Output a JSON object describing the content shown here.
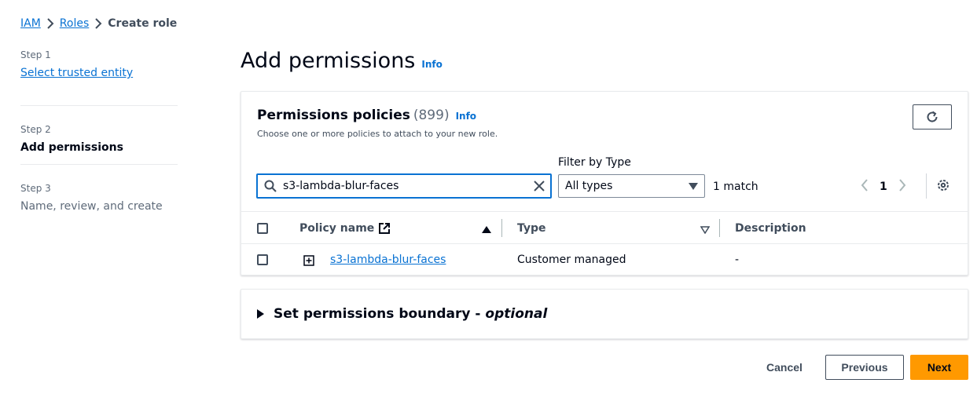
{
  "breadcrumb": {
    "items": [
      "IAM",
      "Roles"
    ],
    "current": "Create role"
  },
  "steps": [
    {
      "num": "Step 1",
      "title": "Select trusted entity"
    },
    {
      "num": "Step 2",
      "title": "Add permissions"
    },
    {
      "num": "Step 3",
      "title": "Name, review, and create"
    }
  ],
  "page": {
    "title": "Add permissions",
    "info": "Info"
  },
  "policies": {
    "title": "Permissions policies",
    "count": "(899)",
    "info": "Info",
    "description": "Choose one or more policies to attach to your new role.",
    "filter_label": "Filter by Type",
    "search_value": "s3-lambda-blur-faces",
    "type_select": "All types",
    "match_text": "1 match",
    "page_number": "1",
    "columns": [
      "Policy name",
      "Type",
      "Description"
    ],
    "rows": [
      {
        "name": "s3-lambda-blur-faces",
        "type": "Customer managed",
        "description": "-"
      }
    ]
  },
  "boundary": {
    "label": "Set permissions boundary - ",
    "optional": "optional"
  },
  "footer": {
    "cancel": "Cancel",
    "previous": "Previous",
    "next": "Next"
  },
  "colors": {
    "link": "#0972d3",
    "primary_button": "#ff9900",
    "text": "#000716"
  }
}
